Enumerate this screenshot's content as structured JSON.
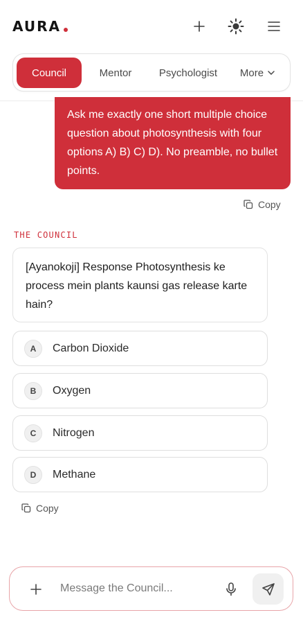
{
  "app": {
    "logo_text": "AURA",
    "accent_color": "#cf2f3a"
  },
  "header": {
    "icons": [
      "plus-icon",
      "sun-icon",
      "menu-icon"
    ]
  },
  "tabs": [
    {
      "label": "Council",
      "active": true
    },
    {
      "label": "Mentor",
      "active": false
    },
    {
      "label": "Psychologist",
      "active": false
    },
    {
      "label": "More",
      "active": false,
      "has_dropdown": true
    }
  ],
  "conversation": {
    "user_message": "Ask me exactly one short multiple choice question about photosynthesis with four options A) B) C) D). No preamble, no bullet points.",
    "user_copy_label": "Copy",
    "council_label": "THE COUNCIL",
    "council_response": "[Ayanokoji] Response Photosynthesis ke process mein plants kaunsi gas release karte hain?",
    "options": [
      {
        "letter": "A",
        "text": "Carbon Dioxide"
      },
      {
        "letter": "B",
        "text": "Oxygen"
      },
      {
        "letter": "C",
        "text": "Nitrogen"
      },
      {
        "letter": "D",
        "text": "Methane"
      }
    ],
    "council_copy_label": "Copy"
  },
  "composer": {
    "placeholder": "Message the Council...",
    "value": ""
  }
}
